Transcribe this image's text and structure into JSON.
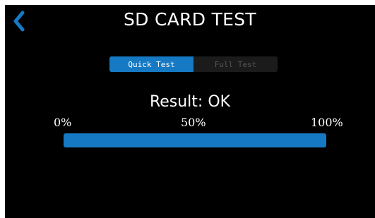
{
  "header": {
    "title": "SD CARD TEST",
    "back_icon": "chevron-left-icon"
  },
  "tabs": [
    {
      "label": "Quick Test",
      "active": true
    },
    {
      "label": "Full Test",
      "active": false
    }
  ],
  "result": {
    "text": "Result: OK"
  },
  "progress": {
    "fraction": 1.0,
    "labels": [
      "0%",
      "50%",
      "100%"
    ]
  },
  "colors": {
    "accent": "#1679c3",
    "background": "#000000",
    "text": "#ffffff",
    "inactive_tab_bg": "#1b1b1b",
    "inactive_tab_text": "#555555"
  }
}
